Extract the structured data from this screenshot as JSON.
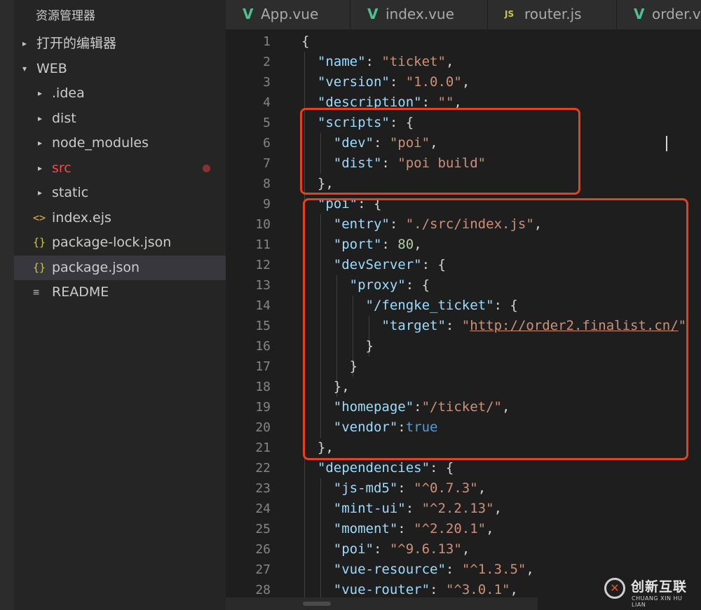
{
  "sidebar": {
    "title": "资源管理器",
    "rows": [
      {
        "label": "打开的编辑器",
        "twisty": "▸",
        "icon": "",
        "icon_name": "chevron-right-icon"
      },
      {
        "label": "WEB",
        "twisty": "▾",
        "icon": "",
        "icon_name": "chevron-down-icon"
      },
      {
        "label": ".idea",
        "twisty": "▸",
        "icon": "",
        "icon_name": "chevron-right-icon"
      },
      {
        "label": "dist",
        "twisty": "▸",
        "icon": "",
        "icon_name": "chevron-right-icon"
      },
      {
        "label": "node_modules",
        "twisty": "▸",
        "icon": "",
        "icon_name": "chevron-right-icon"
      },
      {
        "label": "src",
        "twisty": "▸",
        "icon": "",
        "icon_name": "chevron-right-icon",
        "status": "modified-dot"
      },
      {
        "label": "static",
        "twisty": "▸",
        "icon": "",
        "icon_name": "chevron-right-icon"
      },
      {
        "label": "index.ejs",
        "twisty": "",
        "icon": "<>",
        "icon_name": "ejs-file-icon"
      },
      {
        "label": "package-lock.json",
        "twisty": "",
        "icon": "{}",
        "icon_name": "json-file-icon"
      },
      {
        "label": "package.json",
        "twisty": "",
        "icon": "{}",
        "icon_name": "json-file-icon",
        "selected": true
      },
      {
        "label": "README",
        "twisty": "",
        "icon": "≡",
        "icon_name": "readme-file-icon"
      }
    ]
  },
  "tabs": [
    {
      "label": "App.vue",
      "icon": "V",
      "icon_name": "vue-file-icon"
    },
    {
      "label": "index.vue",
      "icon": "V",
      "icon_name": "vue-file-icon"
    },
    {
      "label": "router.js",
      "icon": "JS",
      "icon_name": "js-file-icon"
    },
    {
      "label": "order.v",
      "icon": "V",
      "icon_name": "vue-file-icon"
    }
  ],
  "editor": {
    "lines": [
      {
        "num": "1",
        "segments": [
          [
            "p",
            "{"
          ]
        ]
      },
      {
        "num": "2",
        "segments": [
          [
            "p",
            "  "
          ],
          [
            "k",
            "\"name\""
          ],
          [
            "p",
            ": "
          ],
          [
            "s",
            "\"ticket\""
          ],
          [
            "p",
            ","
          ]
        ]
      },
      {
        "num": "3",
        "segments": [
          [
            "p",
            "  "
          ],
          [
            "k",
            "\"version\""
          ],
          [
            "p",
            ": "
          ],
          [
            "s",
            "\"1.0.0\""
          ],
          [
            "p",
            ","
          ]
        ]
      },
      {
        "num": "4",
        "segments": [
          [
            "p",
            "  "
          ],
          [
            "k",
            "\"description\""
          ],
          [
            "p",
            ": "
          ],
          [
            "s",
            "\"\""
          ],
          [
            "p",
            ","
          ]
        ]
      },
      {
        "num": "5",
        "segments": [
          [
            "p",
            "  "
          ],
          [
            "k",
            "\"scripts\""
          ],
          [
            "p",
            ": {"
          ]
        ]
      },
      {
        "num": "6",
        "segments": [
          [
            "p",
            "    "
          ],
          [
            "k",
            "\"dev\""
          ],
          [
            "p",
            ": "
          ],
          [
            "s",
            "\"poi\""
          ],
          [
            "p",
            ","
          ]
        ]
      },
      {
        "num": "7",
        "segments": [
          [
            "p",
            "    "
          ],
          [
            "k",
            "\"dist\""
          ],
          [
            "p",
            ": "
          ],
          [
            "s",
            "\"poi build\""
          ]
        ]
      },
      {
        "num": "8",
        "segments": [
          [
            "p",
            "  },"
          ]
        ]
      },
      {
        "num": "9",
        "segments": [
          [
            "p",
            "  "
          ],
          [
            "k",
            "\"poi\""
          ],
          [
            "p",
            ": {"
          ]
        ]
      },
      {
        "num": "10",
        "segments": [
          [
            "p",
            "    "
          ],
          [
            "k",
            "\"entry\""
          ],
          [
            "p",
            ": "
          ],
          [
            "s",
            "\"./src/index.js\""
          ],
          [
            "p",
            ","
          ]
        ]
      },
      {
        "num": "11",
        "segments": [
          [
            "p",
            "    "
          ],
          [
            "k",
            "\"port\""
          ],
          [
            "p",
            ": "
          ],
          [
            "n",
            "80"
          ],
          [
            "p",
            ","
          ]
        ]
      },
      {
        "num": "12",
        "segments": [
          [
            "p",
            "    "
          ],
          [
            "k",
            "\"devServer\""
          ],
          [
            "p",
            ": {"
          ]
        ]
      },
      {
        "num": "13",
        "segments": [
          [
            "p",
            "      "
          ],
          [
            "k",
            "\"proxy\""
          ],
          [
            "p",
            ": {"
          ]
        ]
      },
      {
        "num": "14",
        "segments": [
          [
            "p",
            "        "
          ],
          [
            "k",
            "\"/fengke_ticket\""
          ],
          [
            "p",
            ": {"
          ]
        ]
      },
      {
        "num": "15",
        "segments": [
          [
            "p",
            "          "
          ],
          [
            "k",
            "\"target\""
          ],
          [
            "p",
            ": "
          ],
          [
            "s",
            "\""
          ],
          [
            "u",
            "http://order2.finalist.cn/"
          ],
          [
            "s",
            "\""
          ]
        ]
      },
      {
        "num": "16",
        "segments": [
          [
            "p",
            "        }"
          ]
        ]
      },
      {
        "num": "17",
        "segments": [
          [
            "p",
            "      }"
          ]
        ]
      },
      {
        "num": "18",
        "segments": [
          [
            "p",
            "    },"
          ]
        ]
      },
      {
        "num": "19",
        "segments": [
          [
            "p",
            "    "
          ],
          [
            "k",
            "\"homepage\""
          ],
          [
            "p",
            ":"
          ],
          [
            "s",
            "\"/ticket/\""
          ],
          [
            "p",
            ","
          ]
        ]
      },
      {
        "num": "20",
        "segments": [
          [
            "p",
            "    "
          ],
          [
            "k",
            "\"vendor\""
          ],
          [
            "p",
            ":"
          ],
          [
            "b",
            "true"
          ]
        ]
      },
      {
        "num": "21",
        "segments": [
          [
            "p",
            "  },"
          ]
        ]
      },
      {
        "num": "22",
        "segments": [
          [
            "p",
            "  "
          ],
          [
            "k",
            "\"dependencies\""
          ],
          [
            "p",
            ": {"
          ]
        ]
      },
      {
        "num": "23",
        "segments": [
          [
            "p",
            "    "
          ],
          [
            "k",
            "\"js-md5\""
          ],
          [
            "p",
            ": "
          ],
          [
            "s",
            "\"^0.7.3\""
          ],
          [
            "p",
            ","
          ]
        ]
      },
      {
        "num": "24",
        "segments": [
          [
            "p",
            "    "
          ],
          [
            "k",
            "\"mint-ui\""
          ],
          [
            "p",
            ": "
          ],
          [
            "s",
            "\"^2.2.13\""
          ],
          [
            "p",
            ","
          ]
        ]
      },
      {
        "num": "25",
        "segments": [
          [
            "p",
            "    "
          ],
          [
            "k",
            "\"moment\""
          ],
          [
            "p",
            ": "
          ],
          [
            "s",
            "\"^2.20.1\""
          ],
          [
            "p",
            ","
          ]
        ]
      },
      {
        "num": "26",
        "segments": [
          [
            "p",
            "    "
          ],
          [
            "k",
            "\"poi\""
          ],
          [
            "p",
            ": "
          ],
          [
            "s",
            "\"^9.6.13\""
          ],
          [
            "p",
            ","
          ]
        ]
      },
      {
        "num": "27",
        "segments": [
          [
            "p",
            "    "
          ],
          [
            "k",
            "\"vue-resource\""
          ],
          [
            "p",
            ": "
          ],
          [
            "s",
            "\"^1.3.5\""
          ],
          [
            "p",
            ","
          ]
        ]
      },
      {
        "num": "28",
        "segments": [
          [
            "p",
            "    "
          ],
          [
            "k",
            "\"vue-router\""
          ],
          [
            "p",
            ": "
          ],
          [
            "s",
            "\"^3.0.1\""
          ],
          [
            "p",
            ","
          ]
        ]
      }
    ]
  },
  "watermark": {
    "logo_glyph": "✕",
    "brand_cn": "创新互联",
    "brand_en": "CHUANG XIN HU LIAN"
  },
  "colors": {
    "highlight_box": "#e8401c",
    "vue_green": "#4fc08d",
    "js_yellow": "#cbcb41"
  }
}
